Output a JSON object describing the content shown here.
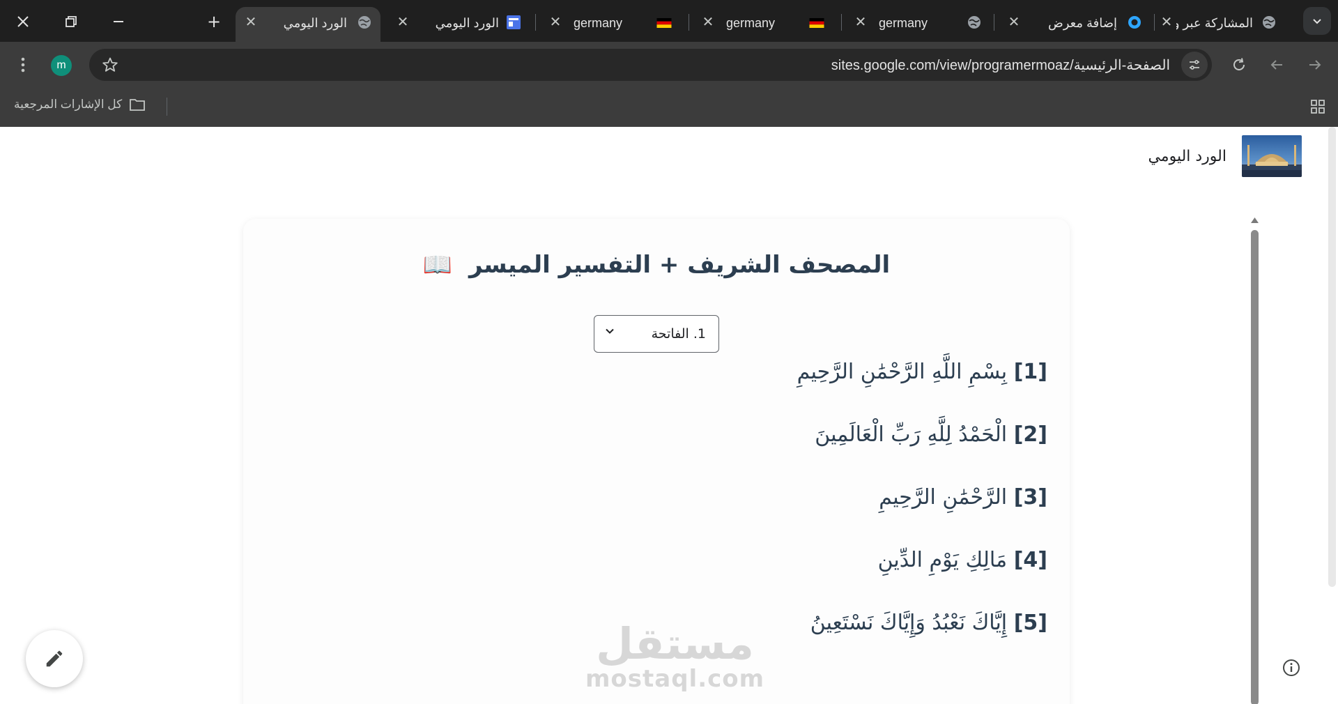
{
  "browser": {
    "tabs": [
      {
        "title": "المشاركة عبر و",
        "icon": "globe-icon"
      },
      {
        "title": "إضافة معرض",
        "icon": "ring-icon"
      },
      {
        "title": "germany",
        "icon": "globe-icon"
      },
      {
        "title": "germany",
        "icon": "germany-flag-icon"
      },
      {
        "title": "germany",
        "icon": "germany-flag-icon"
      },
      {
        "title": "الورد اليومي",
        "icon": "sites-icon"
      },
      {
        "title": "الورد اليومي",
        "icon": "globe-icon",
        "active": true
      }
    ],
    "new_tab_symbol": "+",
    "url": "sites.google.com/view/programermoaz/الصفحة-الرئيسية",
    "profile_initial": "m",
    "bookmarks_all_label": "كل الإشارات المرجعية"
  },
  "site": {
    "title": "الورد اليومي"
  },
  "quran": {
    "heading": "المصحف الشريف + التفسير الميسر",
    "heading_icon": "📖",
    "surah_selected": "1. الفاتحة",
    "ayat": [
      {
        "num": "[1]",
        "text": "بِسْمِ اللَّهِ الرَّحْمَٰنِ الرَّحِيمِ"
      },
      {
        "num": "[2]",
        "text": "الْحَمْدُ لِلَّهِ رَبِّ الْعَالَمِينَ"
      },
      {
        "num": "[3]",
        "text": "الرَّحْمَٰنِ الرَّحِيمِ"
      },
      {
        "num": "[4]",
        "text": "مَالِكِ يَوْمِ الدِّينِ"
      },
      {
        "num": "[5]",
        "text": "إِيَّاكَ نَعْبُدُ وَإِيَّاكَ نَسْتَعِينُ"
      }
    ]
  },
  "watermark": {
    "arabic": "مستقل",
    "latin": "mostaql.com"
  },
  "colors": {
    "tabstrip_bg": "#1f1f1f",
    "toolbar_bg": "#3c3c3c",
    "heading_text": "#2c3e50",
    "profile_avatar": "#0f8f7a"
  }
}
